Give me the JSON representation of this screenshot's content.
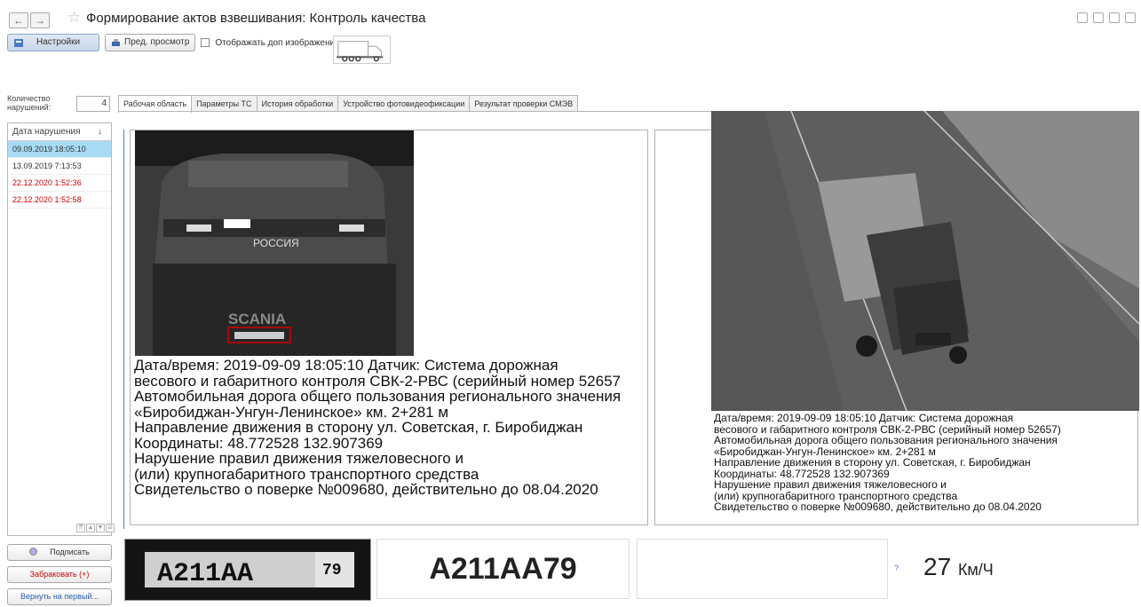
{
  "window": {
    "title": "Формирование актов взвешивания: Контроль качества",
    "back_label": "←",
    "forward_label": "→",
    "star_label": "☆"
  },
  "toolbar": {
    "settings_label": "Настройки",
    "preview_label": "Пред. просмотр",
    "extra_images_label": "Отображать доп изображения"
  },
  "left_panel": {
    "count_label": "Количество нарушений:",
    "count_value": "4",
    "list_header": "Дата нарушения",
    "sort_arrow": "↓",
    "items": [
      {
        "text": "09.09.2019 18:05:10"
      },
      {
        "text": "13.09.2019 7:13:53"
      },
      {
        "text": "22.12.2020 1:52:36"
      },
      {
        "text": "22.12.2020 1:52:58"
      }
    ],
    "sign_label": "Подписать",
    "reject_label": "Забраковать (+)",
    "return_label": "Вернуть на первый..."
  },
  "tabs": [
    {
      "label": "Рабочая область"
    },
    {
      "label": "Параметры ТС"
    },
    {
      "label": "История обработки"
    },
    {
      "label": "Устройство фотовидеофиксации"
    },
    {
      "label": "Результат проверки СМЭВ"
    }
  ],
  "photo_left": {
    "brand": "SCANIA",
    "russia": "РОССИЯ",
    "caption": "Дата/время: 2019-09-09 18:05:10 Датчик: Система дорожная\nвесового и габаритного контроля СВК-2-РВС (серийный номер 52657\nАвтомобильная дорога общего пользования регионального значения\n«Биробиджан-Унгун-Ленинское» км. 2+281 м\nНаправление движения в сторону ул. Советская, г. Биробиджан\nКоординаты: 48.772528 132.907369\nНарушение правил движения тяжеловесного и\n(или) крупногабаритного транспортного средства\nСвидетельство о поверке №009680, действительно до 08.04.2020"
  },
  "photo_right": {
    "caption": "Дата/время: 2019-09-09 18:05:10 Датчик: Система дорожная\nвесового и габаритного контроля СВК-2-РВС (серийный номер 52657)\nАвтомобильная дорога общего пользования регионального значения\n«Биробиджан-Унгун-Ленинское» км. 2+281 м\nНаправление движения в сторону ул. Советская, г. Биробиджан\nКоординаты: 48.772528 132.907369\nНарушение правил движения тяжеловесного и\n(или) крупногабаритного транспортного средства\nСвидетельство о поверке №009680, действительно до 08.04.2020"
  },
  "plate": {
    "image_text": "A211AA",
    "image_region": "79",
    "recognized": "A211AA79"
  },
  "speed": {
    "qmark": "?",
    "value": "27",
    "unit": "Км/Ч"
  },
  "colors": {
    "selected_row": "#a8dcf5",
    "error_red": "#d00000",
    "accent_blue": "#4a7ac9"
  }
}
